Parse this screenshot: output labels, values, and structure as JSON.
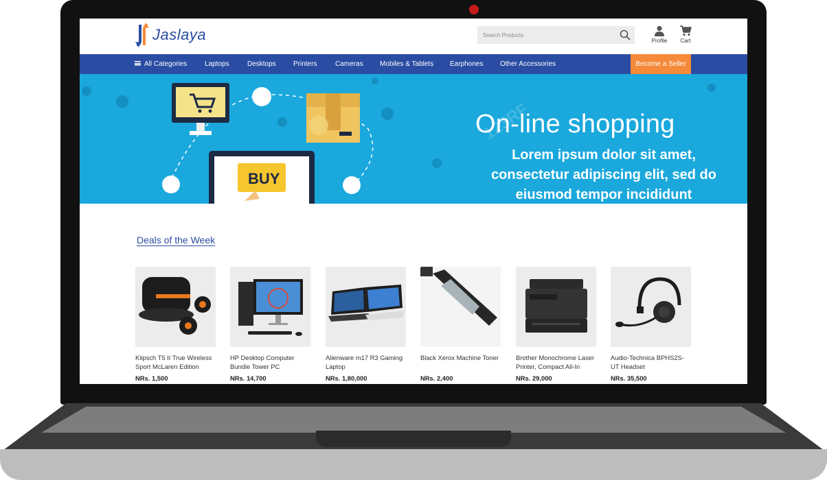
{
  "brand": {
    "name": "Jaslaya"
  },
  "search": {
    "placeholder": "Search Products"
  },
  "header_actions": [
    {
      "label": "Profile",
      "icon": "user-icon"
    },
    {
      "label": "Cart",
      "icon": "cart-icon"
    }
  ],
  "nav": {
    "items": [
      "All Categories",
      "Laptops",
      "Desktops",
      "Printers",
      "Cameras",
      "Mobiles & Tablets",
      "Earphones",
      "Other Accessories"
    ],
    "cta": "Become a Seller"
  },
  "banner": {
    "headline": "On-line shopping",
    "subtext": "Lorem ipsum dolor sit amet, consectetur adipiscing elit, sed do eiusmod tempor incididunt",
    "buy_label": "BUY",
    "watermark": "123RF"
  },
  "deals": {
    "title": "Deals of the Week",
    "products": [
      {
        "name": "Klipsch T5 II True Wireless Sport McLaren Edition",
        "price": "NRs. 1,500",
        "icon": "earbuds-icon"
      },
      {
        "name": "HP Desktop Computer Bundle Tower PC",
        "price": "NRs. 14,700",
        "icon": "desktop-icon"
      },
      {
        "name": "Alienware m17 R3 Gaming Laptop",
        "price": "NRs. 1,80,000",
        "icon": "laptop-icon"
      },
      {
        "name": "Black Xerox Machine Toner",
        "price": "NRs. 2,400",
        "icon": "toner-icon"
      },
      {
        "name": "Brother Monochrome Laser Printer, Compact All-In",
        "price": "NRs. 29,000",
        "icon": "printer-icon"
      },
      {
        "name": "Audio-Technica BPHS2S-UT Headset",
        "price": "NRs. 35,500",
        "icon": "headset-icon"
      }
    ]
  },
  "colors": {
    "brand_blue": "#2a4da3",
    "accent_orange": "#f58a3a",
    "banner_blue": "#1aa8dd"
  }
}
